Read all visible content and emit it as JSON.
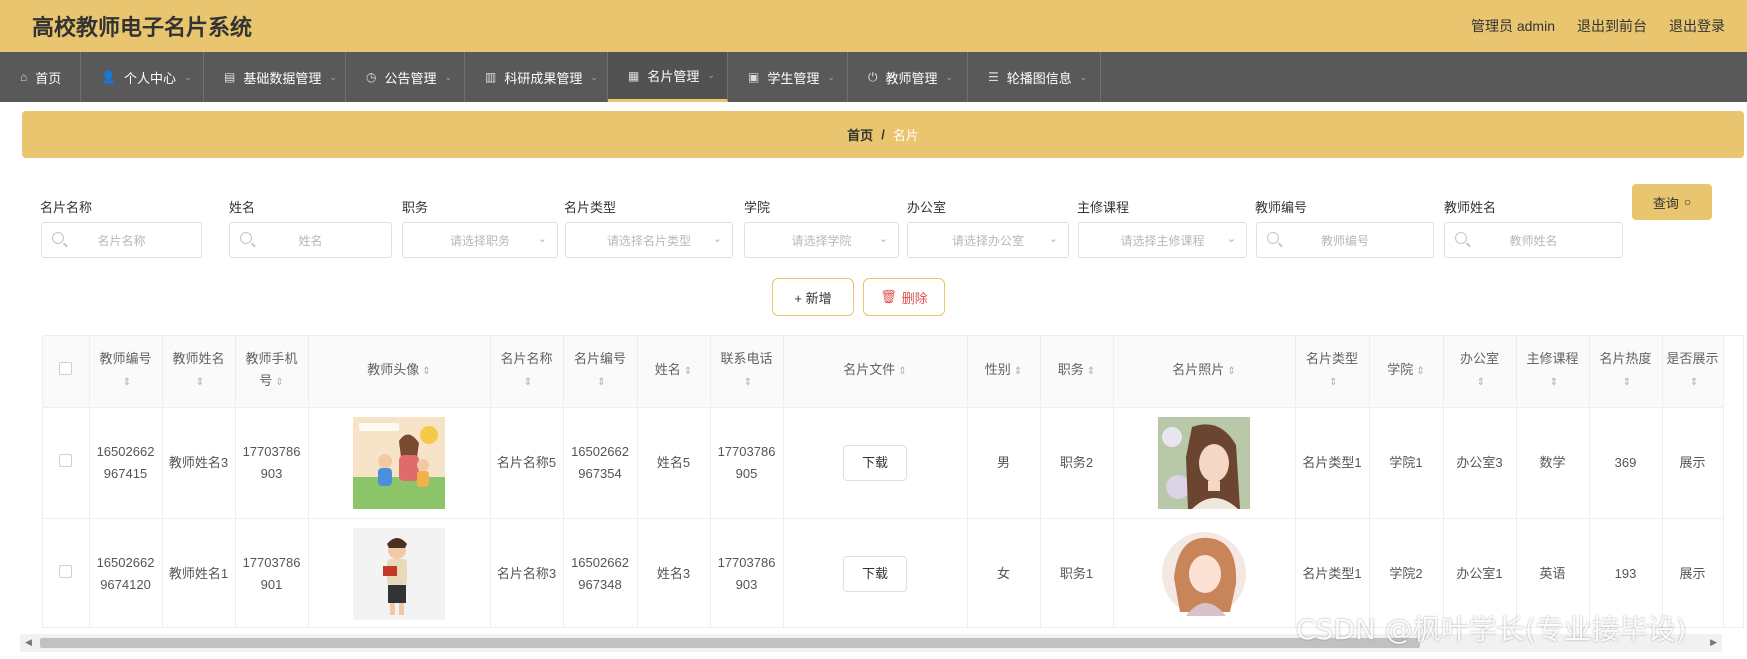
{
  "header": {
    "app_title": "高校教师电子名片系统",
    "admin_label": "管理员 admin",
    "front_link": "退出到前台",
    "logout_link": "退出登录"
  },
  "nav": [
    {
      "label": "首页",
      "icon": "home-icon"
    },
    {
      "label": "个人中心",
      "icon": "user-icon",
      "caret": true
    },
    {
      "label": "基础数据管理",
      "icon": "database-icon",
      "caret": true
    },
    {
      "label": "公告管理",
      "icon": "clock-icon",
      "caret": true
    },
    {
      "label": "科研成果管理",
      "icon": "printer-icon",
      "caret": true
    },
    {
      "label": "名片管理",
      "icon": "grid-icon",
      "caret": true,
      "active": true
    },
    {
      "label": "学生管理",
      "icon": "card-icon",
      "caret": true
    },
    {
      "label": "教师管理",
      "icon": "power-icon",
      "caret": true
    },
    {
      "label": "轮播图信息",
      "icon": "list-icon",
      "caret": true
    }
  ],
  "breadcrumb": {
    "home": "首页",
    "separator": "/",
    "current": "名片"
  },
  "filters": [
    {
      "label": "名片名称",
      "placeholder": "名片名称",
      "kind": "text"
    },
    {
      "label": "姓名",
      "placeholder": "姓名",
      "kind": "text"
    },
    {
      "label": "职务",
      "placeholder": "请选择职务",
      "kind": "select"
    },
    {
      "label": "名片类型",
      "placeholder": "请选择名片类型",
      "kind": "select"
    },
    {
      "label": "学院",
      "placeholder": "请选择学院",
      "kind": "select"
    },
    {
      "label": "办公室",
      "placeholder": "请选择办公室",
      "kind": "select"
    },
    {
      "label": "主修课程",
      "placeholder": "请选择主修课程",
      "kind": "select"
    },
    {
      "label": "教师编号",
      "placeholder": "教师编号",
      "kind": "text"
    },
    {
      "label": "教师姓名",
      "placeholder": "教师姓名",
      "kind": "text"
    }
  ],
  "buttons": {
    "query": "查询",
    "add": "+ 新增",
    "delete": "删除",
    "download": "下载"
  },
  "table": {
    "columns": [
      "教师编号",
      "教师姓名",
      "教师手机号",
      "教师头像",
      "名片名称",
      "名片编号",
      "姓名",
      "联系电话",
      "名片文件",
      "性别",
      "职务",
      "名片照片",
      "名片类型",
      "学院",
      "办公室",
      "主修课程",
      "名片热度",
      "是否展示"
    ],
    "rows": [
      {
        "teacher_no": "16502662967415",
        "teacher_name": "教师姓名3",
        "teacher_phone": "17703786903",
        "card_name": "名片名称5",
        "card_no": "16502662967354",
        "name": "姓名5",
        "phone": "17703786905",
        "gender": "男",
        "position": "职务2",
        "card_type": "名片类型1",
        "college": "学院1",
        "office": "办公室3",
        "course": "数学",
        "hot": "369",
        "show": "展示"
      },
      {
        "teacher_no": "165026629674120",
        "teacher_name": "教师姓名1",
        "teacher_phone": "17703786901",
        "card_name": "名片名称3",
        "card_no": "16502662967348",
        "name": "姓名3",
        "phone": "17703786903",
        "gender": "女",
        "position": "职务1",
        "card_type": "名片类型1",
        "college": "学院2",
        "office": "办公室1",
        "course": "英语",
        "hot": "193",
        "show": "展示"
      }
    ]
  },
  "watermark": "CSDN @枫叶学长(专业接毕设)"
}
